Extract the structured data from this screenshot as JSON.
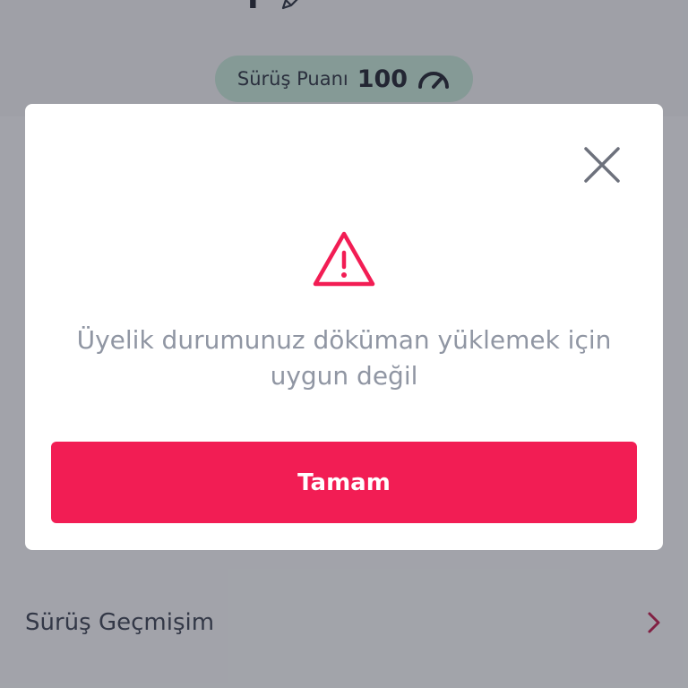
{
  "profile": {
    "name": "Y",
    "edit_icon": "pencil-icon"
  },
  "score": {
    "label": "Sürüş Puanı",
    "value": "100",
    "icon": "gauge-icon"
  },
  "menu": {
    "history_label": "Sürüş Geçmişim",
    "history_icon": "chevron-right-icon"
  },
  "dialog": {
    "close_icon": "close-icon",
    "alert_icon": "warning-icon",
    "message": "Üyelik durumunuz döküman yüklemek için uygun değil",
    "ok_label": "Tamam"
  },
  "colors": {
    "accent": "#f21d54",
    "score_pill": "#c8ead9",
    "message_text": "#9096a3",
    "overlay": "#6b6e79"
  }
}
